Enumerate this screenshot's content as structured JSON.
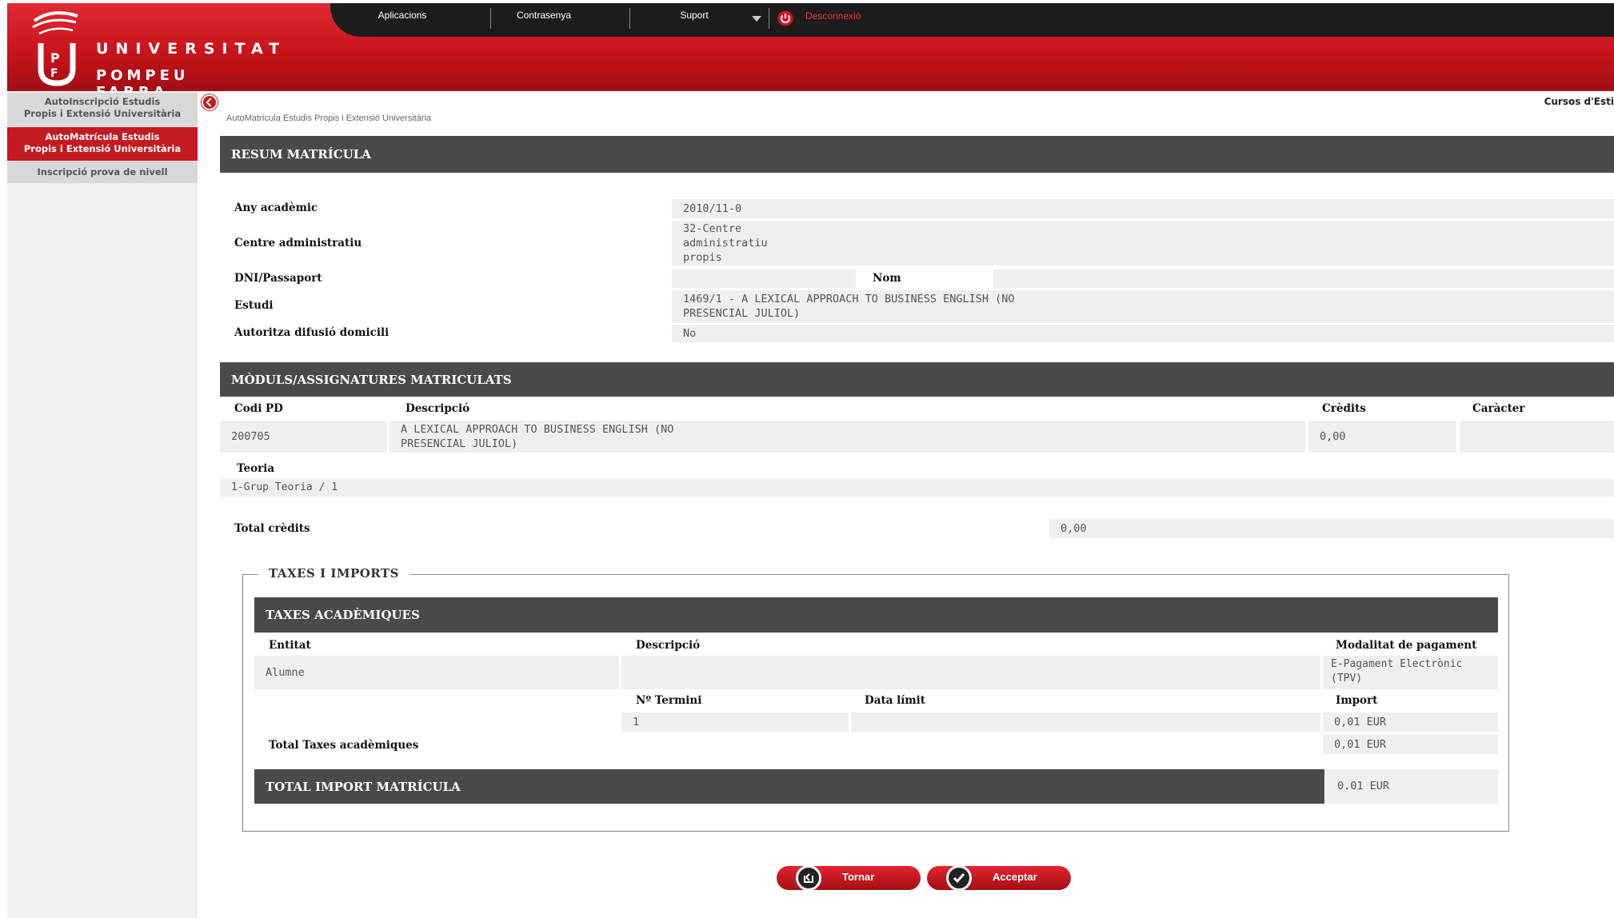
{
  "header": {
    "logo_line1": "UNIVERSITAT",
    "logo_line2": "POMPEU FABRA",
    "nav": [
      "Aplicacions",
      "Contrasenya",
      "Suport"
    ],
    "logout": "Desconnexió"
  },
  "sidebar": {
    "items": [
      {
        "line1": "AutoInscripció Estudis",
        "line2": "Propis i Extensió Universitària"
      },
      {
        "line1": "AutoMatrícula Estudis",
        "line2": "Propis i Extensió Universitària"
      },
      {
        "line1": "Inscripció prova de nivell"
      }
    ]
  },
  "courses_link": "Cursos d'Esti",
  "breadcrumb": "AutoMatrícula Estudis Propis i Extensió Universitària",
  "resum": {
    "title": "RESUM MATRÍCULA",
    "any_label": "Any acadèmic",
    "any_value": "2010/11-0",
    "centre_label": "Centre administratiu",
    "centre_value": [
      "32-Centre",
      "administratiu",
      "propis"
    ],
    "dni_label": "DNI/Passaport",
    "dni_value": "",
    "nom_label": "Nom",
    "nom_value": "",
    "estudi_label": "Estudi",
    "estudi_value": [
      "1469/1 - A LEXICAL APPROACH TO BUSINESS ENGLISH (NO",
      "PRESENCIAL JULIOL)"
    ],
    "autoritza_label": "Autoritza difusió domicili",
    "autoritza_value": "No"
  },
  "moduls": {
    "title": "MÒDULS/ASSIGNATURES MATRICULATS",
    "headers": {
      "codi": "Codi PD",
      "descripcio": "Descripció",
      "credits": "Crèdits",
      "caracter": "Caràcter"
    },
    "row": {
      "codi": "200705",
      "descripcio": [
        "A LEXICAL APPROACH TO BUSINESS ENGLISH (NO",
        "PRESENCIAL JULIOL)"
      ],
      "credits": "0,00",
      "caracter": ""
    },
    "teoria_label": "Teoria",
    "teoria_value": "1-Grup Teoria / 1",
    "total_label": "Total crèdits",
    "total_value": "0,00"
  },
  "taxes": {
    "legend": "TAXES I IMPORTS",
    "title": "TAXES ACADÈMIQUES",
    "headers": {
      "entitat": "Entitat",
      "descripcio": "Descripció",
      "modalitat": "Modalitat de pagament"
    },
    "entitat": "Alumne",
    "modalitat": [
      "E-Pagament Electrònic",
      "(TPV)"
    ],
    "sub_headers": {
      "termini": "Nº Termini",
      "data": "Data límit",
      "import": "Import"
    },
    "termini": "1",
    "data": "",
    "import": "0,01 EUR",
    "total_label": "Total Taxes acadèmiques",
    "total_value": "0,01 EUR",
    "total_import_label": "TOTAL IMPORT MATRÍCULA",
    "total_import_value": "0.01 EUR"
  },
  "buttons": {
    "back": "Tornar",
    "accept": "Acceptar"
  },
  "colors": {
    "brand_red": "#c41a22",
    "dark_bar": "#4a4a4a",
    "nav_dark": "#1c1c1c"
  }
}
